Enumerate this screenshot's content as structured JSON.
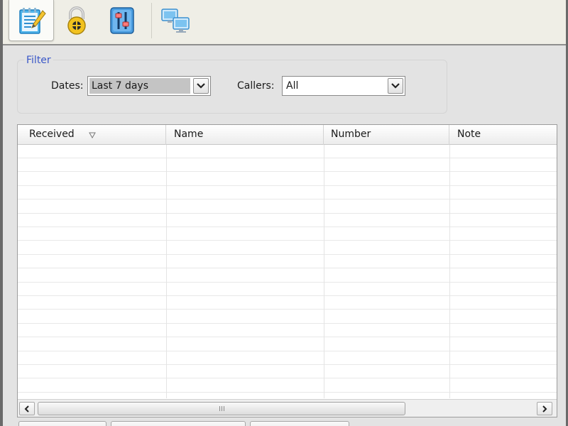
{
  "toolbar": {
    "buttons": [
      {
        "icon": "call-log-notepad-icon",
        "active": true
      },
      {
        "icon": "padlock-icon",
        "active": false
      },
      {
        "icon": "settings-sliders-icon",
        "active": false
      },
      {
        "icon": "network-computers-icon",
        "active": false
      }
    ]
  },
  "filter": {
    "legend": "Filter",
    "dates_label": "Dates:",
    "dates_value": "Last 7 days",
    "callers_label": "Callers:",
    "callers_value": "All"
  },
  "table": {
    "columns": [
      "Received",
      "Name",
      "Number",
      "Note"
    ],
    "sort_column": "Received",
    "rows": []
  },
  "colors": {
    "legend_blue": "#3a57c8",
    "window_bg": "#e3e3e3",
    "toolbar_bg": "#efeee6"
  }
}
